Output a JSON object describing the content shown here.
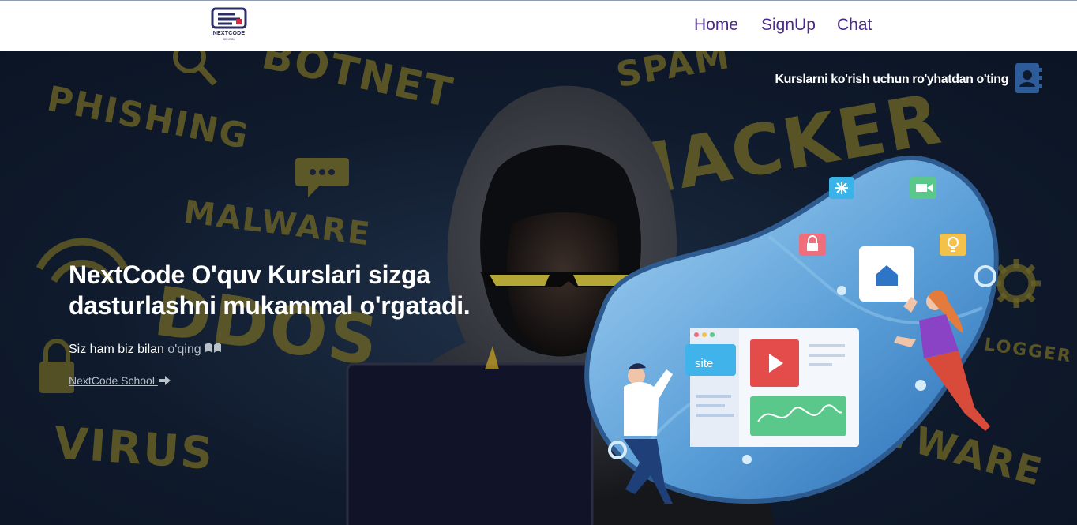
{
  "header": {
    "logo_text": "NEXTCODE",
    "logo_subtext": "SCHOOL",
    "nav": [
      {
        "label": "Home"
      },
      {
        "label": "SignUp"
      },
      {
        "label": "Chat"
      }
    ]
  },
  "hero": {
    "register_text": "Kurslarni ko'rish uchun ro'yhatdan o'ting",
    "title": "NextCode O'quv Kurslari sizga dasturlashni mukammal o'rgatadi.",
    "subtitle_prefix": "Siz ham biz bilan",
    "subtitle_link": "o'qing",
    "school_link": "NextCode School",
    "background_words": [
      "PHISHING",
      "BOTNET",
      "SPAM",
      "HACKER",
      "MALWARE",
      "DDOS",
      "VIRUS",
      "SPYWARE",
      "LOGGER"
    ],
    "illustration_site_label": "site"
  },
  "colors": {
    "nav_text": "#4b2a88",
    "logo": "#1e2350",
    "blob": "#5b9fd8"
  },
  "icons": [
    "address-book-icon",
    "book-open-icon",
    "arrow-right-icon",
    "home-icon",
    "lock-icon",
    "snowflake-icon",
    "video-icon",
    "lightbulb-icon",
    "play-icon"
  ]
}
